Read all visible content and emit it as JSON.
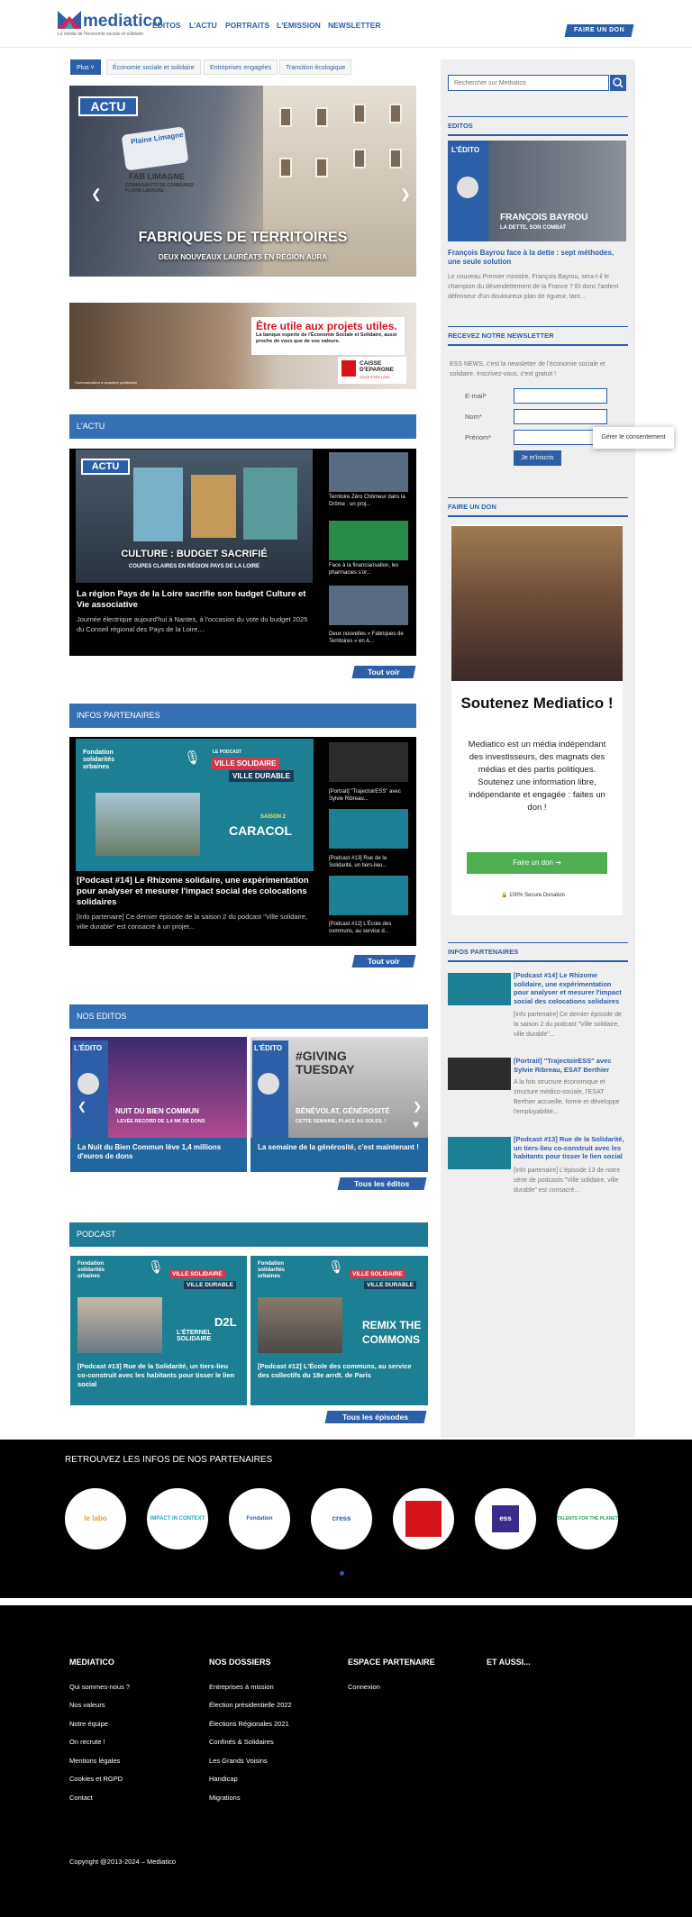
{
  "header": {
    "logo_text": "mediatico",
    "logo_sub": "Le média de l'économie sociale et solidaire",
    "nav": [
      "EDITOS",
      "L'ACTU",
      "PORTRAITS",
      "L'EMISSION",
      "NEWSLETTER"
    ],
    "don_button": "FAIRE UN DON"
  },
  "tabs": [
    "Plus ˅",
    "Économie sociale et solidaire",
    "Entreprises engagées",
    "Transition écologique"
  ],
  "hero": {
    "tag": "ACTU",
    "title": "FABRIQUES DE TERRITOIRES",
    "subtitle": "DEUX NOUVEAUX LAURÉATS EN RÉGION AURA",
    "sign1": "Plaine Limagne",
    "sign2": "FAB LIMAGNE",
    "sign3": "COMMUNAUTÉ DE COMMUNES PLAINE LIMAGNE"
  },
  "ad": {
    "headline": "Être utile aux projets utiles.",
    "text": "La banque experte de l'Économie Sociale et Solidaire, aussi proche de vous que de vos valeurs.",
    "brand": "CAISSE D'EPARGNE",
    "brand_sub": "VOUS ÊTES LOIN",
    "note": "Communication à caractère publicitaire"
  },
  "actu": {
    "header": "L'ACTU",
    "tag": "ACTU",
    "img_title": "CULTURE : BUDGET SACRIFIÉ",
    "img_sub": "COUPES CLAIRES EN RÉGION PAYS DE LA LOIRE",
    "title": "La région Pays de la Loire sacrifie son budget Culture et Vie associative",
    "excerpt": "Journée électrique aujourd'hui à Nantes, à l'occasion du vote du budget 2025 du Conseil régional des Pays de la Loire,...",
    "side": [
      "Territoire Zéro Chômeur dans la Drôme : un proj...",
      "Face à la financiarisation, les pharmacies s'or...",
      "Deux nouvelles « Fabriques de Territoires » en A..."
    ],
    "more": "Tout voir"
  },
  "partners": {
    "header": "INFOS PARTENAIRES",
    "fondation": "Fondation solidarités urbaines",
    "podcast": "LE PODCAST",
    "badge1": "VILLE SOLIDAIRE",
    "badge2": "VILLE DURABLE",
    "saison": "SAISON 2",
    "name": "CARACOL",
    "title": "[Podcast #14] Le Rhizome solidaire, une expérimentation pour analyser et mesurer l'impact social des colocations solidaires",
    "excerpt": "[Info partenaire] Ce dernier épisode de la saison 2 du podcast \"Ville solidaire, ville durable\" est consacré à un projet...",
    "side": [
      "[Portrait] \"TrajectoirESS\" avec Sylvie Ribreau...",
      "[Podcast #13] Rue de la Solidarité, un tiers-lieu...",
      "[Podcast #12] L'École des communs, au service d..."
    ],
    "more": "Tout voir"
  },
  "editos": {
    "header": "NOS EDITOS",
    "tag": "L'ÉDITO",
    "cards": [
      {
        "img_title": "NUIT DU BIEN COMMUN",
        "img_sub": "LEVÉE RECORD DE 1,4 M€ DE DONS",
        "title": "La Nuit du Bien Commun lève 1,4 millions d'euros de dons"
      },
      {
        "img_top": "#GIVING TUESDAY",
        "img_title": "BÉNÉVOLAT, GÉNÉROSITÉ",
        "img_sub": "CETTE SEMAINE, PLACE AU SOLEIL !",
        "title": "La semaine de la générosité, c'est maintenant !"
      }
    ],
    "more": "Tous les éditos"
  },
  "podcast": {
    "header": "PODCAST",
    "cards": [
      {
        "name1": "D2L",
        "name2": "L'ÉTERNEL SOLIDAIRE",
        "title": "[Podcast #13] Rue de la Solidarité, un tiers-lieu co-construit avec les habitants pour tisser le lien social"
      },
      {
        "name1": "REMIX THE",
        "name2": "COMMONS",
        "title": "[Podcast #12] L'École des communs, au service des collectifs du 18e arrdt. de Paris"
      }
    ],
    "more": "Tous les épisodes"
  },
  "sidebar": {
    "search_placeholder": "Rechercher sur Mediatico",
    "editos_h": "EDITOS",
    "edito_tag": "L'ÉDITO",
    "edito_img_title": "FRANÇOIS BAYROU",
    "edito_img_sub": "LA DETTE, SON COMBAT",
    "edito_title": "François Bayrou face à la dette : sept méthodes, une seule solution",
    "edito_excerpt": "Le nouveau Premier ministre, François Bayrou, sera-t-il le champion du désendettement de la France ? Et donc l'ardent défenseur d'un douloureux plan de rigueur, tant...",
    "newsletter_h": "RECEVEZ NOTRE NEWSLETTER",
    "newsletter_text": "ESS NEWS, c'est la newsletter de l'économie sociale et solidaire. Inscrivez-vous, c'est gratuit !",
    "email": "E-mail*",
    "nom": "Nom*",
    "prenom": "Prénom*",
    "submit": "Je m'inscris",
    "consent": "Gérer le consentement",
    "don_h": "FAIRE UN DON",
    "don_title": "Soutenez Mediatico !",
    "don_text": "Mediatico est un média indépendant des investisseurs, des magnats des médias et des partis politiques. Soutenez une information libre, indépendante et engagée : faites un don !",
    "don_btn": "Faire un don",
    "secure": "100% Secure Donation",
    "partners_h": "INFOS PARTENAIRES",
    "partners": [
      {
        "title": "[Podcast #14] Le Rhizome solidaire, une expérimentation pour analyser et mesurer l'impact social des colocations solidaires",
        "excerpt": "[Info partenaire] Ce dernier épisode de la saison 2 du podcast \"Ville solidaire, ville durable\"..."
      },
      {
        "title": "[Portrait] \"TrajectoirESS\" avec Sylvie Ribreau, ESAT Berthier",
        "excerpt": "A la fois structure économique et structure médico-sociale, l'ESAT Berthier accueille, forme et développe l'employabilité..."
      },
      {
        "title": "[Podcast #13] Rue de la Solidarité, un tiers-lieu co-construit avec les habitants pour tisser le lien social",
        "excerpt": "[Info partenaire] L'épisode 13 de notre série de podcasts \"Ville solidaire, ville durable\" est consacré..."
      }
    ]
  },
  "band": {
    "title": "RETROUVEZ LES INFOS DE NOS PARTENAIRES",
    "logos": [
      "le labo",
      "IMPACT IN CONTEXT",
      "Fondation",
      "cress",
      "",
      "ess",
      "TALENTS FOR THE PLANET"
    ]
  },
  "footer": {
    "cols": [
      {
        "h": "MEDIATICO",
        "links": [
          "Qui sommes-nous ?",
          "Nos valeurs",
          "Notre équipe",
          "On recrute !",
          "Mentions légales",
          "Cookies et RGPD",
          "Contact"
        ]
      },
      {
        "h": "NOS DOSSIERS",
        "links": [
          "Entreprises à mission",
          "Élection présidentielle 2022",
          "Élections Régionales 2021",
          "Confinés & Solidaires",
          "Les Grands Voisins",
          "Handicap",
          "Migrations"
        ]
      },
      {
        "h": "ESPACE PARTENAIRE",
        "links": [
          "Connexion"
        ]
      },
      {
        "h": "ET AUSSI...",
        "links": []
      }
    ],
    "copyright": "Copyright @2013-2024 – Mediatico"
  }
}
